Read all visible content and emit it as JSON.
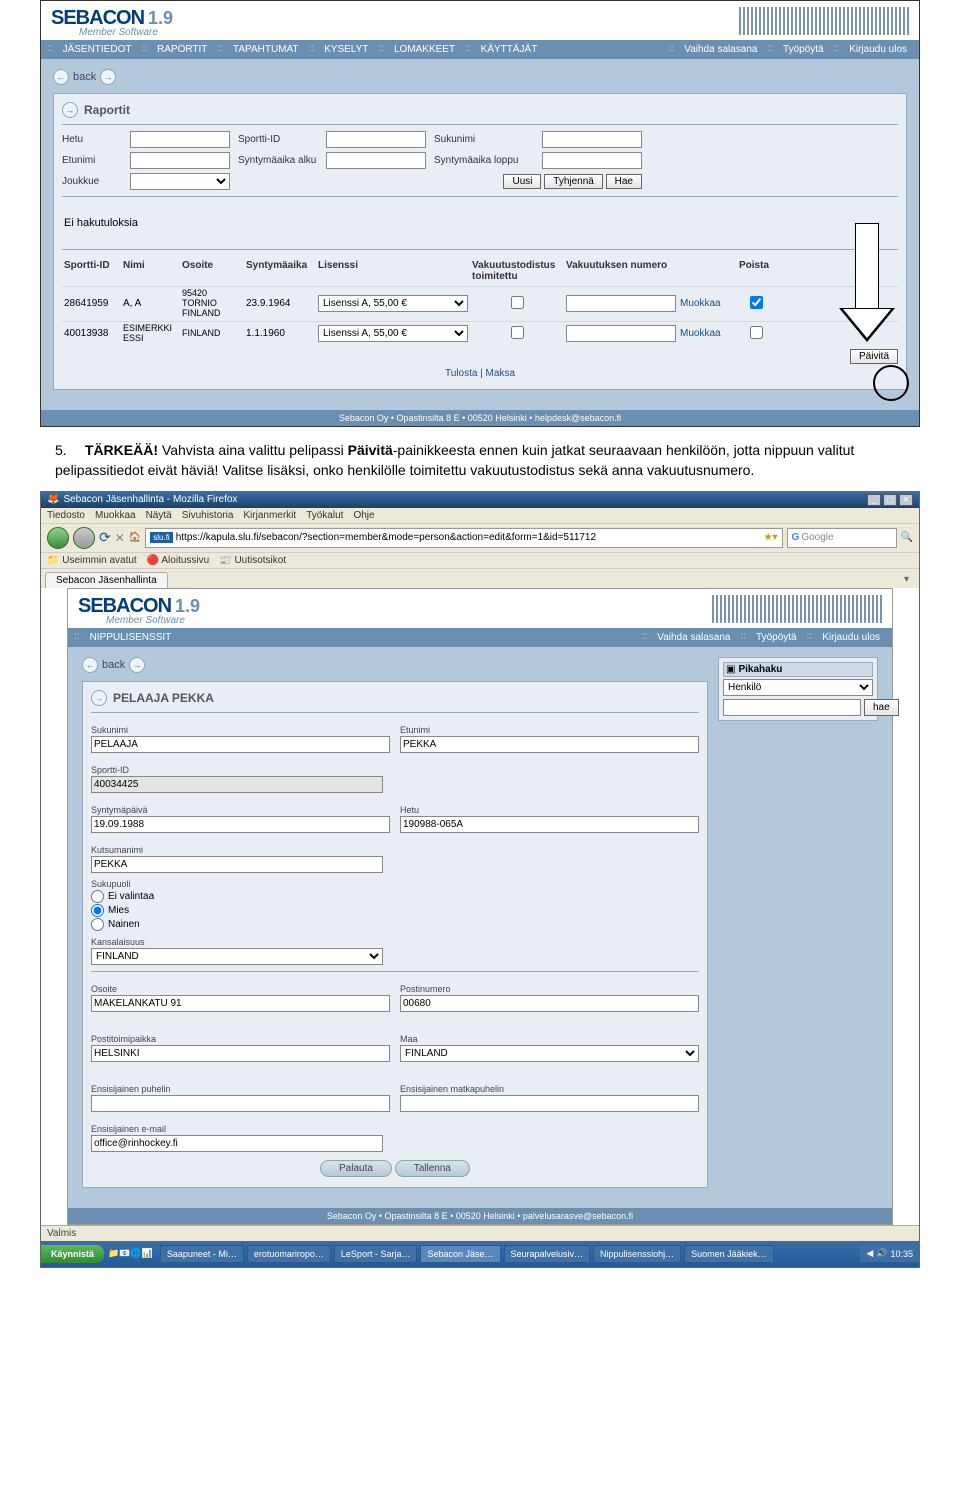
{
  "instruction": {
    "num": "5.",
    "bold1": "TÄRKEÄÄ!",
    "text1": " Vahvista aina valittu pelipassi ",
    "bold2": "Päivitä",
    "text2": "-painikkeesta ennen kuin jatkat seuraavaan henkilöön, jotta nippuun valitut pelipassitiedot eivät häviä! Valitse lisäksi, onko henkilölle toimitettu vakuutustodistus sekä anna vakuutusnumero."
  },
  "app1": {
    "brand": "SEBAC",
    "brand2": "ON",
    "version": "1.9",
    "tagline": "Member Software",
    "menu": [
      "JÄSENTIEDOT",
      "RAPORTIT",
      "TAPAHTUMAT",
      "KYSELYT",
      "LOMAKKEET",
      "KÄYTTÄJÄT"
    ],
    "menu_right": [
      "Vaihda salasana",
      "Työpöytä",
      "Kirjaudu ulos"
    ],
    "back": "back",
    "panel_title": "Raportit",
    "search": {
      "hetu": "Hetu",
      "sportti": "Sportti-ID",
      "sukunimi": "Sukunimi",
      "etunimi": "Etunimi",
      "synt_alku": "Syntymäaika alku",
      "synt_loppu": "Syntymäaika loppu",
      "joukkue": "Joukkue",
      "uusi": "Uusi",
      "tyhjenna": "Tyhjennä",
      "hae": "Hae"
    },
    "no_results": "Ei hakutuloksia",
    "cols": [
      "Sportti-ID",
      "Nimi",
      "Osoite",
      "Syntymäaika",
      "Lisenssi",
      "Vakuutustodistus toimitettu",
      "Vakuutuksen numero",
      "",
      "Poista"
    ],
    "rows": [
      {
        "id": "28641959",
        "name": "A, A",
        "addr": "95420 TORNIO FINLAND",
        "dob": "23.9.1964",
        "lic": "Lisenssi A, 55,00 €",
        "edit": "Muokkaa",
        "del": true
      },
      {
        "id": "40013938",
        "name": "ESIMERKKI ESSI",
        "addr": "FINLAND",
        "dob": "1.1.1960",
        "lic": "Lisenssi A, 55,00 €",
        "edit": "Muokkaa",
        "del": false
      }
    ],
    "paivita": "Päivitä",
    "midlinks": "Tulosta | Maksa",
    "footer": "Sebacon Oy • Opastinsilta 8 E • 00520 Helsinki • helpdesk@sebacon.fi"
  },
  "browser": {
    "title": "Sebacon Jäsenhallinta - Mozilla Firefox",
    "menu": [
      "Tiedosto",
      "Muokkaa",
      "Näytä",
      "Sivuhistoria",
      "Kirjanmerkit",
      "Työkalut",
      "Ohje"
    ],
    "url": "https://kapula.slu.fi/sebacon/?section=member&mode=person&action=edit&form=1&id=511712",
    "url_badge": "slu.fi",
    "search_ph": "Google",
    "bookmarks": [
      "Useimmin avatut",
      "Aloitussivu",
      "Uutisotsikot"
    ],
    "tab": "Sebacon Jäsenhallinta",
    "status": "Valmis"
  },
  "app2": {
    "menu": [
      "NIPPULISENSSIT"
    ],
    "menu_right": [
      "Vaihda salasana",
      "Työpöytä",
      "Kirjaudu ulos"
    ],
    "back": "back",
    "quick": {
      "title": "Pikahaku",
      "type": "Henkilö",
      "btn": "hae"
    },
    "person_title": "PELAAJA PEKKA",
    "fields": {
      "sukunimi": {
        "l": "Sukunimi",
        "v": "PELAAJA"
      },
      "etunimi": {
        "l": "Etunimi",
        "v": "PEKKA"
      },
      "sportti": {
        "l": "Sportti-ID",
        "v": "40034425"
      },
      "synt": {
        "l": "Syntymäpäivä",
        "v": "19.09.1988"
      },
      "hetu": {
        "l": "Hetu",
        "v": "190988-065A"
      },
      "kutsuma": {
        "l": "Kutsumanimi",
        "v": "PEKKA"
      },
      "sukupuoli": {
        "l": "Sukupuoli",
        "opts": [
          "Ei valintaa",
          "Mies",
          "Nainen"
        ],
        "sel": 1
      },
      "kansal": {
        "l": "Kansalaisuus",
        "v": "FINLAND"
      },
      "osoite": {
        "l": "Osoite",
        "v": "MÄKELÄNKATU 91"
      },
      "postinum": {
        "l": "Postinumero",
        "v": "00680"
      },
      "postitoim": {
        "l": "Postitoimipaikka",
        "v": "HELSINKI"
      },
      "maa": {
        "l": "Maa",
        "v": "FINLAND"
      },
      "puh": {
        "l": "Ensisijainen puhelin",
        "v": ""
      },
      "matka": {
        "l": "Ensisijainen matkapuhelin",
        "v": ""
      },
      "email": {
        "l": "Ensisijainen e-mail",
        "v": "office@rinhockey.fi"
      }
    },
    "btns": {
      "palauta": "Palauta",
      "tallenna": "Tallenna"
    },
    "footer": "Sebacon Oy • Opastinsilta 8 E • 00520 Helsinki • palvelusarasve@sebacon.fi"
  },
  "taskbar": {
    "start": "Käynnistä",
    "items": [
      "Saapuneet - Mi…",
      "erotuomariropo…",
      "LeSport - Sarja…",
      "Sebacon Jäse…",
      "Seurapalvelusiv…",
      "Nippulisenssiohj…",
      "Suomen Jääkiek…"
    ],
    "clock": "10:35"
  }
}
